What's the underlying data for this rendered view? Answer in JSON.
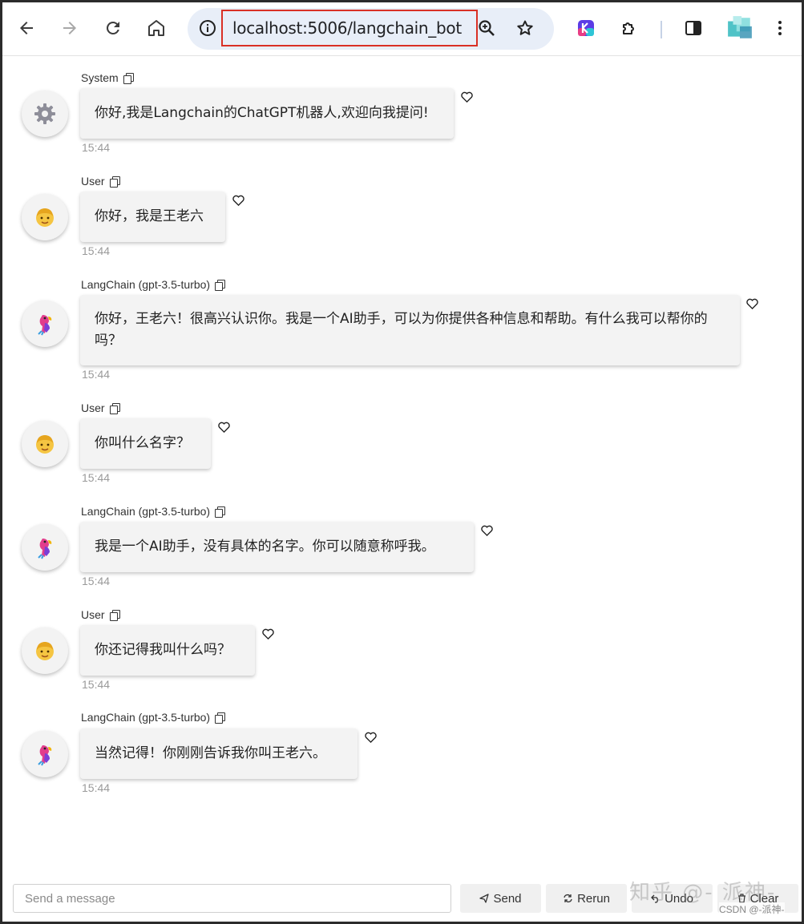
{
  "browser": {
    "url": "localhost:5006/langchain_bot",
    "icons": [
      "back-arrow-icon",
      "forward-arrow-icon",
      "reload-icon",
      "home-icon",
      "site-info-icon",
      "zoom-icon",
      "bookmark-star-icon",
      "extension-app-icon",
      "puzzle-extensions-icon",
      "side-panel-icon",
      "profile-icon",
      "menu-kebab-icon"
    ]
  },
  "messages": [
    {
      "sender": "System",
      "text": "你好,我是Langchain的ChatGPT机器人,欢迎向我提问!",
      "time": "15:44",
      "avatar": "gear-icon"
    },
    {
      "sender": "User",
      "text": "你好，我是王老六",
      "time": "15:44",
      "avatar": "user-face-icon"
    },
    {
      "sender": "LangChain (gpt-3.5-turbo)",
      "text": "你好，王老六！很高兴认识你。我是一个AI助手，可以为你提供各种信息和帮助。有什么我可以帮你的吗？",
      "time": "15:44",
      "avatar": "parrot-icon"
    },
    {
      "sender": "User",
      "text": "你叫什么名字？",
      "time": "15:44",
      "avatar": "user-face-icon"
    },
    {
      "sender": "LangChain (gpt-3.5-turbo)",
      "text": "我是一个AI助手，没有具体的名字。你可以随意称呼我。",
      "time": "15:44",
      "avatar": "parrot-icon"
    },
    {
      "sender": "User",
      "text": "你还记得我叫什么吗？",
      "time": "15:44",
      "avatar": "user-face-icon"
    },
    {
      "sender": "LangChain (gpt-3.5-turbo)",
      "text": "当然记得！你刚刚告诉我你叫王老六。",
      "time": "15:44",
      "avatar": "parrot-icon"
    }
  ],
  "input": {
    "placeholder": "Send a message",
    "value": ""
  },
  "actions": {
    "send": "Send",
    "rerun": "Rerun",
    "undo": "Undo",
    "clear": "Clear"
  },
  "watermark": {
    "zhihu": "知乎 @- 派神-",
    "csdn": "CSDN @-派神-"
  }
}
